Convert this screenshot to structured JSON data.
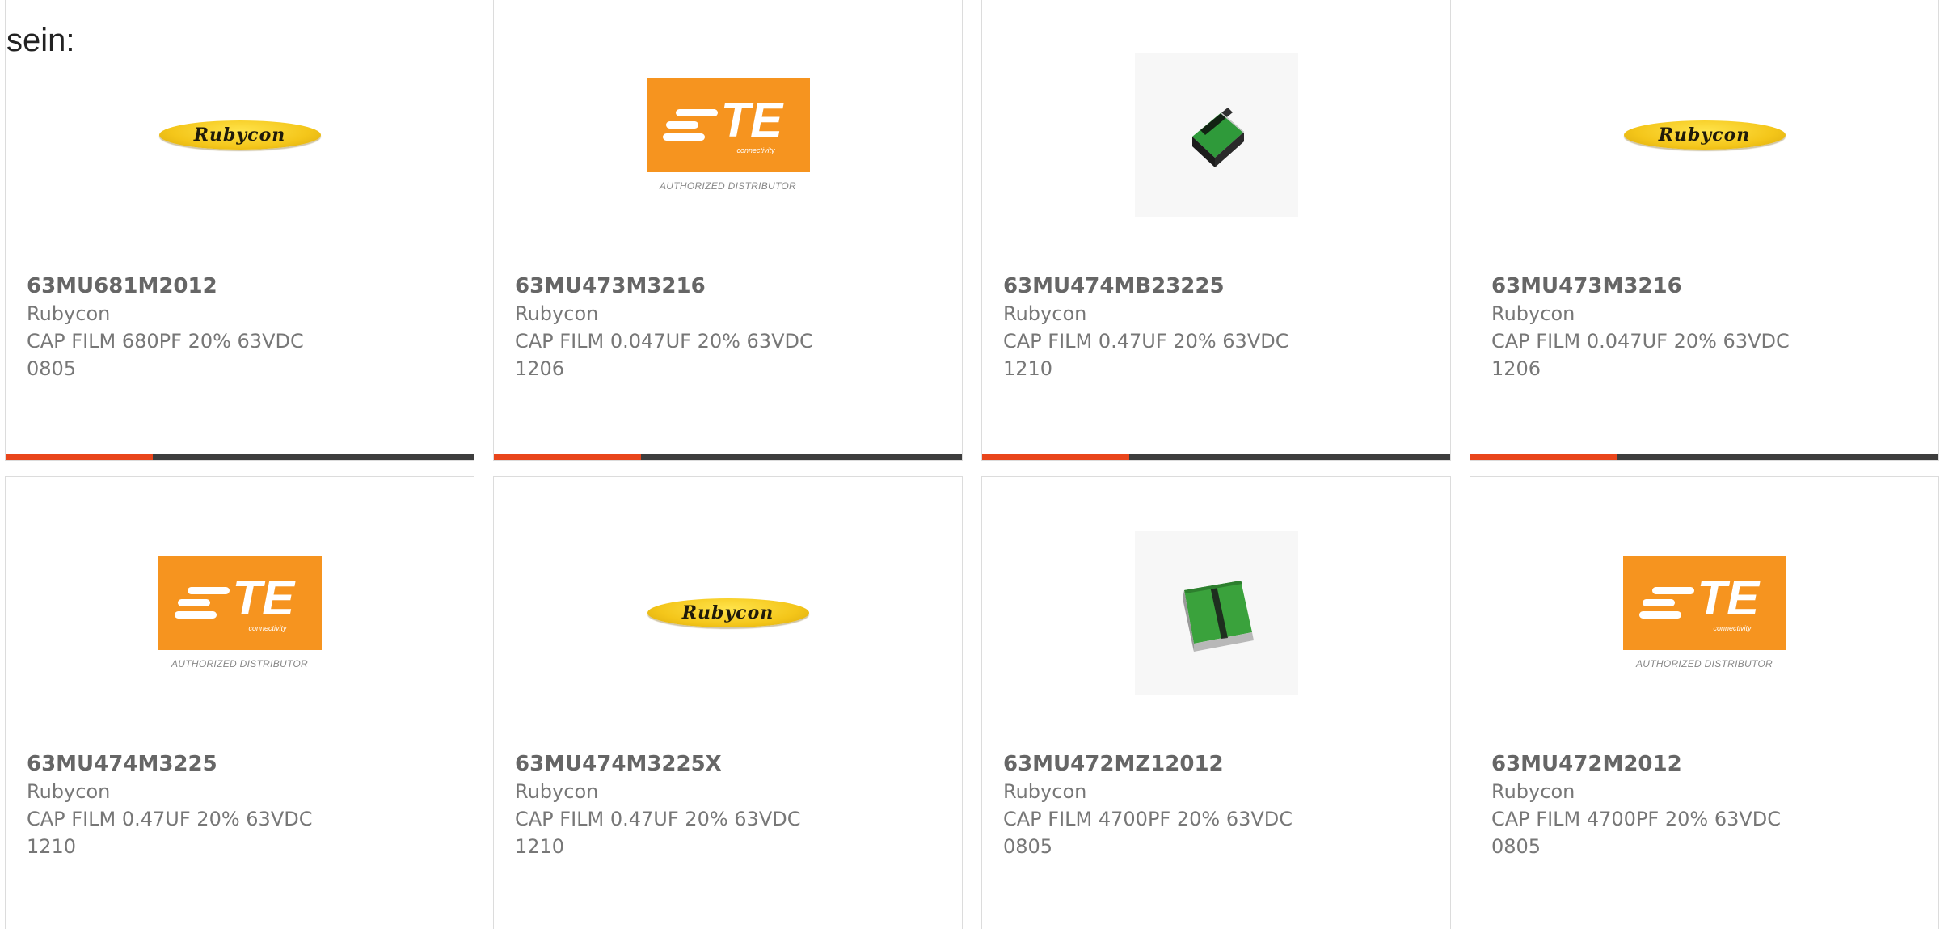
{
  "intro_text": "sein:",
  "colors": {
    "accent": "#e9451b",
    "bar": "#3d3d3d",
    "rubycon_yellow": "#f4c61a",
    "te_orange": "#f6941f"
  },
  "logos": {
    "rubycon": "Rubycon",
    "te_mark": "TE",
    "te_sub": "connectivity",
    "te_authorized": "AUTHORIZED DISTRIBUTOR"
  },
  "products": [
    {
      "part_number": "63MU681M2012",
      "manufacturer": "Rubycon",
      "description": "CAP FILM 680PF 20% 63VDC 0805",
      "image": "rubycon-logo"
    },
    {
      "part_number": "63MU473M3216",
      "manufacturer": "Rubycon",
      "description": "CAP FILM 0.047UF 20% 63VDC 1206",
      "image": "te-logo"
    },
    {
      "part_number": "63MU474MB23225",
      "manufacturer": "Rubycon",
      "description": "CAP FILM 0.47UF 20% 63VDC 1210",
      "image": "chip-photo-small"
    },
    {
      "part_number": "63MU473M3216",
      "manufacturer": "Rubycon",
      "description": "CAP FILM 0.047UF 20% 63VDC 1206",
      "image": "rubycon-logo"
    },
    {
      "part_number": "63MU474M3225",
      "manufacturer": "Rubycon",
      "description": "CAP FILM 0.47UF 20% 63VDC 1210",
      "image": "te-logo"
    },
    {
      "part_number": "63MU474M3225X",
      "manufacturer": "Rubycon",
      "description": "CAP FILM 0.47UF 20% 63VDC 1210",
      "image": "rubycon-logo"
    },
    {
      "part_number": "63MU472MZ12012",
      "manufacturer": "Rubycon",
      "description": "CAP FILM 4700PF 20% 63VDC 0805",
      "image": "chip-photo-large"
    },
    {
      "part_number": "63MU472M2012",
      "manufacturer": "Rubycon",
      "description": "CAP FILM 4700PF 20% 63VDC 0805",
      "image": "te-logo"
    }
  ]
}
